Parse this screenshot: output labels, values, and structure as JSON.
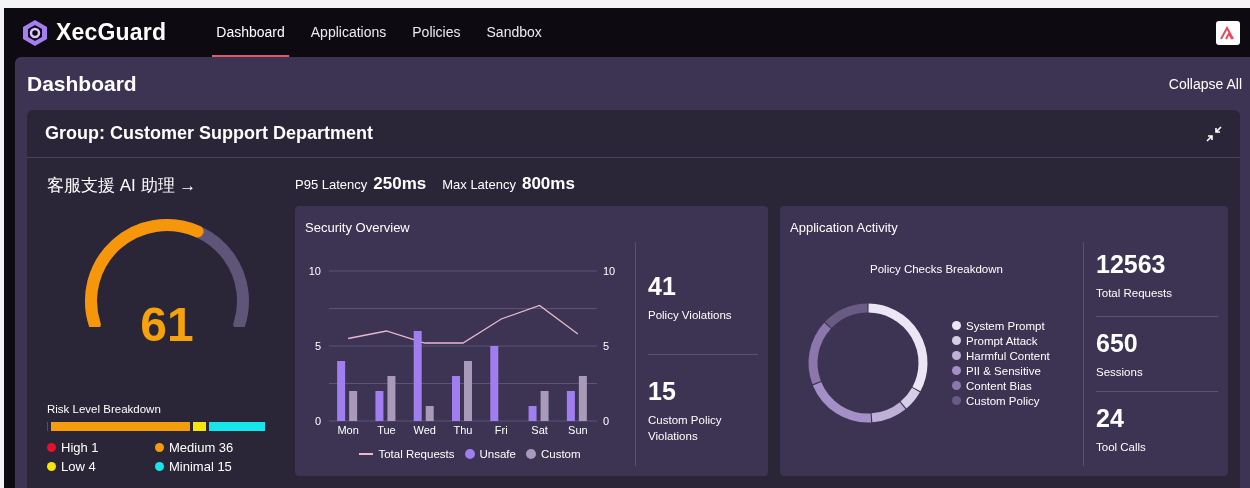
{
  "brand": "XecGuard",
  "nav": [
    {
      "label": "Dashboard",
      "selected": true
    },
    {
      "label": "Applications",
      "selected": false
    },
    {
      "label": "Policies",
      "selected": false
    },
    {
      "label": "Sandbox",
      "selected": false
    }
  ],
  "page_title": "Dashboard",
  "collapse_all": "Collapse All",
  "group": {
    "title": "Group: Customer Support Department",
    "app": {
      "name": "客服支援 AI 助理 →",
      "latency": [
        {
          "label": "P95 Latency",
          "value": "250ms"
        },
        {
          "label": "Max Latency",
          "value": "800ms"
        }
      ],
      "risk": {
        "score": "61",
        "title": "Risk Level Breakdown",
        "levels": [
          {
            "label": "High 1",
            "color": "#e8102e"
          },
          {
            "label": "Medium 36",
            "color": "#f59c0b"
          },
          {
            "label": "Low 4",
            "color": "#f5e50b"
          },
          {
            "label": "Minimal 15",
            "color": "#16e6ec"
          }
        ]
      },
      "security": {
        "title": "Security Overview",
        "right_axis_ticks": [
          "10",
          "5",
          "0"
        ],
        "chart_data": {
          "type": "bar",
          "categories": [
            "Mon",
            "Tue",
            "Wed",
            "Thu",
            "Fri",
            "Sat",
            "Sun"
          ],
          "ylim": [
            0,
            10
          ],
          "yticks": [
            {
              "value": 0,
              "label": "0"
            },
            {
              "value": 5,
              "label": "5"
            },
            {
              "value": 10,
              "label": "10"
            }
          ],
          "series": [
            {
              "name": "Total Requests",
              "color": "#e9b9cf",
              "type": "line",
              "values": [
                5.5,
                6,
                5.2,
                5.2,
                6.8,
                7.7,
                5.8
              ]
            },
            {
              "name": "Unsafe",
              "color": "#a07ef0",
              "values": [
                4,
                2,
                6,
                3,
                5,
                1,
                2
              ]
            },
            {
              "name": "Custom",
              "color": "#a89ab8",
              "values": [
                2,
                3,
                1,
                4,
                0,
                2,
                3
              ]
            }
          ]
        },
        "stats": [
          {
            "value": "41",
            "label": "Policy Violations"
          },
          {
            "value": "15",
            "label": "Custom Policy Violations"
          }
        ]
      },
      "activity": {
        "title": "Application Activity",
        "chart_title": "Policy Checks Breakdown",
        "legend": [
          {
            "label": "System Prompt",
            "color": "#ebe6f3"
          },
          {
            "label": "Prompt Attack",
            "color": "#d6cde6"
          },
          {
            "label": "Harmful Content",
            "color": "#bfb0d8"
          },
          {
            "label": "PII & Sensitive",
            "color": "#a48fc6"
          },
          {
            "label": "Content Bias",
            "color": "#8c77ad"
          },
          {
            "label": "Custom Policy",
            "color": "#6a5b84"
          }
        ],
        "stats": [
          {
            "value": "12563",
            "label": "Total Requests"
          },
          {
            "value": "650",
            "label": "Sessions"
          },
          {
            "value": "24",
            "label": "Tool Calls"
          }
        ]
      }
    }
  }
}
